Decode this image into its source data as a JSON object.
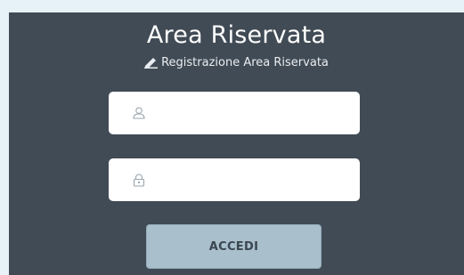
{
  "header": {
    "title": "Area Riservata",
    "register_link": "Registrazione Area Riservata"
  },
  "form": {
    "username": {
      "value": "",
      "placeholder": "",
      "icon": "user-icon"
    },
    "password": {
      "value": "",
      "placeholder": "",
      "icon": "lock-icon"
    },
    "submit_label": "ACCEDI"
  },
  "colors": {
    "panel_bg": "#414b55",
    "page_bg": "#e6f1f8",
    "button_bg": "#a9bfcc",
    "text_light": "#ffffff"
  }
}
